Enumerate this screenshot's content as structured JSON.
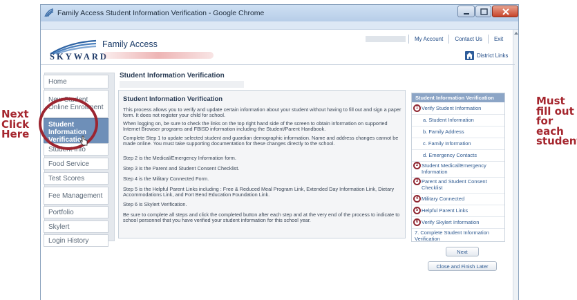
{
  "window": {
    "title": "Family Access Student Information Verification - Google Chrome"
  },
  "header": {
    "brand": "SKYWARD",
    "app_title": "Family Access",
    "links": [
      "My Account",
      "Contact Us",
      "Exit"
    ],
    "district_link": "District Links",
    "district_icon": "building-icon"
  },
  "nav": {
    "items": [
      {
        "label": "Home",
        "active": false
      },
      {
        "label": "New Student Online Enrollment",
        "active": false
      },
      {
        "label": "Student Information Verification",
        "active": true
      },
      {
        "label": "Student Info",
        "active": false
      },
      {
        "label": "Food Service",
        "active": false
      },
      {
        "label": "Test Scores",
        "active": false
      },
      {
        "label": "Fee Management",
        "active": false
      },
      {
        "label": "Portfolio",
        "active": false
      },
      {
        "label": "Skylert",
        "active": false
      },
      {
        "label": "Login History",
        "active": false
      }
    ]
  },
  "main": {
    "page_title": "Student Information Verification",
    "content_title": "Student Information Verification",
    "paragraphs": [
      "This process allows you to verify and update certain information about your student without having to fill out and sign a paper form. It does not register your child for school.",
      "When logging on, be sure to check the links on the top right hand side of the screen to obtain information on supported Internet Browser programs and FBISD information including the Student/Parent Handbook.",
      "Complete Step 1 to update selected student and guardian demographic information. Name and address changes cannot be made online. You must take supporting documentation for these changes directly to the school.",
      "Step 2 is the Medical/Emergency Information form.",
      "Step 3 is the Parent and Student Consent Checklist.",
      "Step 4 is the Military Connected Form.",
      "Step 5 is the Helpful Parent Links including : Free & Reduced Meal Program Link, Extended Day Information Link, Dietary Accommodations Link, and Fort Bend Education Foundation Link.",
      "Step 6 is Skylert Verification.",
      "Be sure to complete all steps and click the completed button after each step and at the very end of the process to indicate to school personnel that you have verified your student information for this school year."
    ]
  },
  "steps": {
    "header": "Student Information Verification",
    "items": [
      {
        "label": "Verify Student Information",
        "num": "1"
      },
      {
        "label": "a. Student Information",
        "sub": true
      },
      {
        "label": "b. Family Address",
        "sub": true
      },
      {
        "label": "c. Family Information",
        "sub": true
      },
      {
        "label": "d. Emergency Contacts",
        "sub": true
      },
      {
        "label": "Student Medical/Emergency Information",
        "num": "2"
      },
      {
        "label": "Parent and Student Consent Checklist",
        "num": "3"
      },
      {
        "label": "Military Connected",
        "num": "4"
      },
      {
        "label": "Helpful Parent Links",
        "num": "5"
      },
      {
        "label": "Verify Skylert Information",
        "num": "6"
      },
      {
        "label": "7. Complete Student Information Verification"
      }
    ],
    "next_label": "Next",
    "close_label": "Close and Finish Later"
  },
  "annotations": {
    "left": "Next Click Here",
    "right": "Must fill out for each student"
  },
  "colors": {
    "brand_blue": "#1e3a68",
    "nav_active": "#6e8fb8",
    "annotation_red": "#a5262e"
  }
}
